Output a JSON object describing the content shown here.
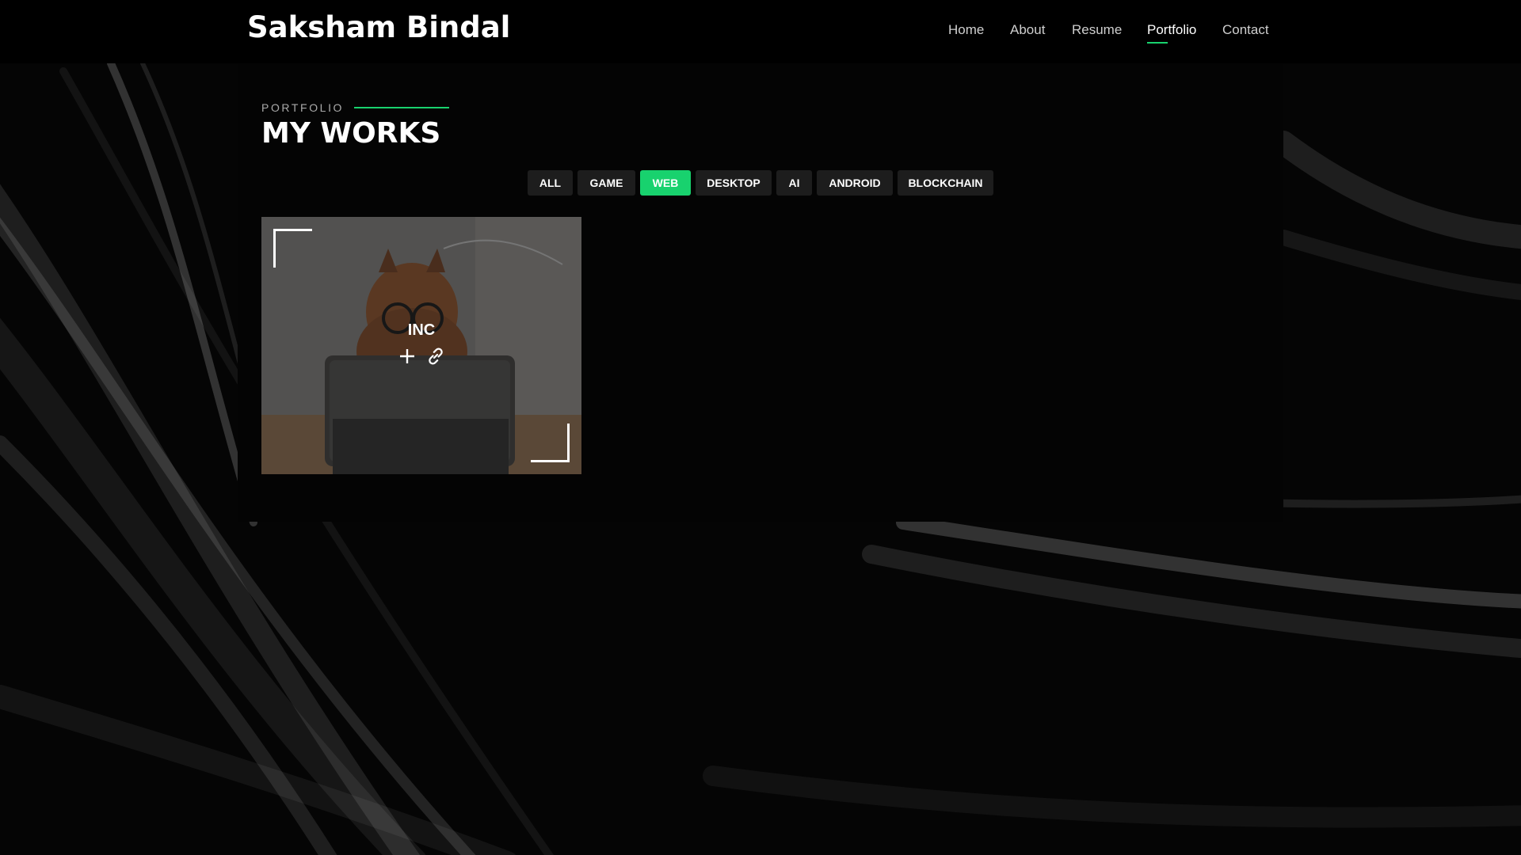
{
  "header": {
    "brand": "Saksham Bindal",
    "nav": [
      {
        "label": "Home",
        "active": false
      },
      {
        "label": "About",
        "active": false
      },
      {
        "label": "Resume",
        "active": false
      },
      {
        "label": "Portfolio",
        "active": true
      },
      {
        "label": "Contact",
        "active": false
      }
    ]
  },
  "section": {
    "eyebrow": "PORTFOLIO",
    "title": "MY WORKS"
  },
  "filters": [
    {
      "label": "ALL",
      "active": false
    },
    {
      "label": "GAME",
      "active": false
    },
    {
      "label": "WEB",
      "active": true
    },
    {
      "label": "DESKTOP",
      "active": false
    },
    {
      "label": "AI",
      "active": false
    },
    {
      "label": "ANDROID",
      "active": false
    },
    {
      "label": "BLOCKCHAIN",
      "active": false
    }
  ],
  "portfolio": {
    "items": [
      {
        "title": "INC",
        "actions": [
          "plus-icon",
          "link-icon"
        ]
      }
    ]
  },
  "colors": {
    "accent": "#18d26e",
    "background": "#000000",
    "panel": "#040404",
    "filter_bg": "#1d1d1d"
  }
}
